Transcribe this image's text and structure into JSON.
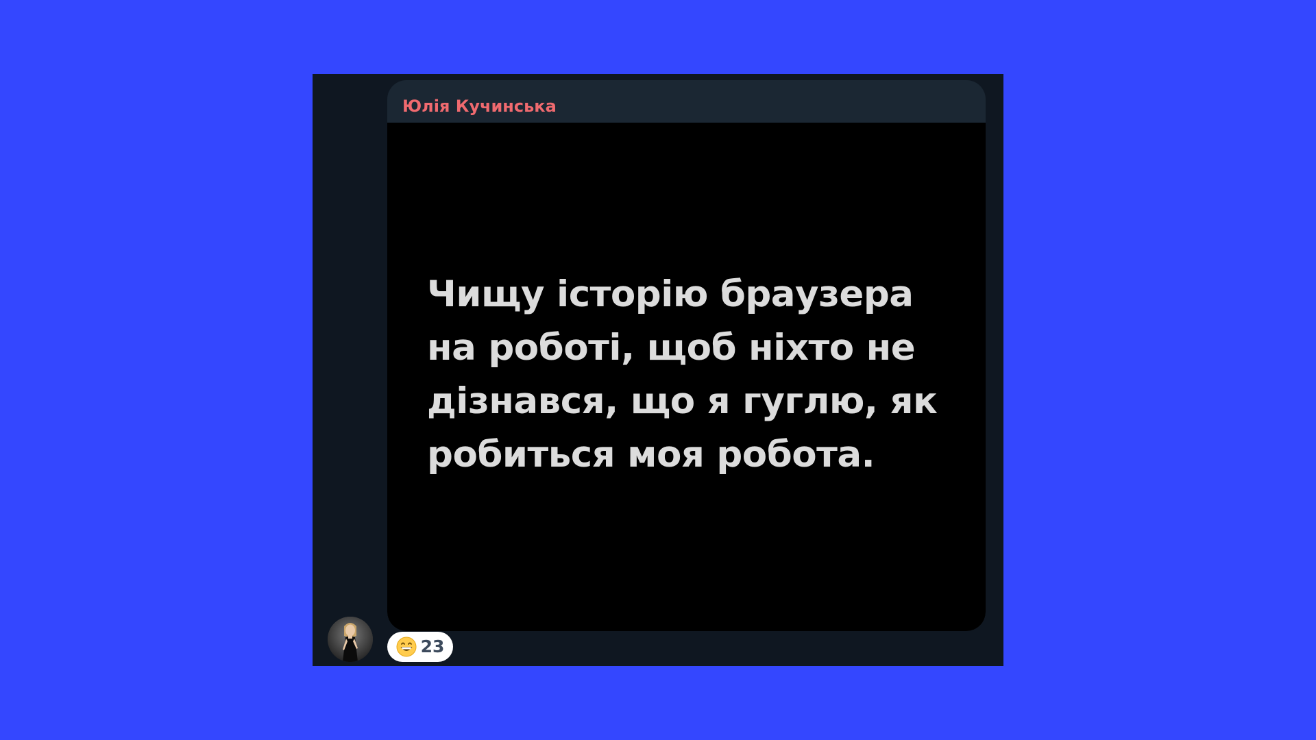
{
  "message": {
    "sender_name": "Юлія Кучинська",
    "image_text_lines": [
      "Чищу історію браузера",
      "на роботі, щоб ніхто не",
      "дізнався, що я гуглю, як",
      "робиться моя робота."
    ],
    "reaction": {
      "emoji": "grinning-face-emoji",
      "count": "23"
    }
  },
  "colors": {
    "page_background": "#3447ff",
    "chat_background": "#0f1721",
    "bubble_background": "#1b2733",
    "sender_name": "#f06a6f",
    "image_background": "#000000",
    "image_text": "#dcdcdc",
    "reaction_background": "#ffffff",
    "reaction_count": "#3c4a5c"
  }
}
